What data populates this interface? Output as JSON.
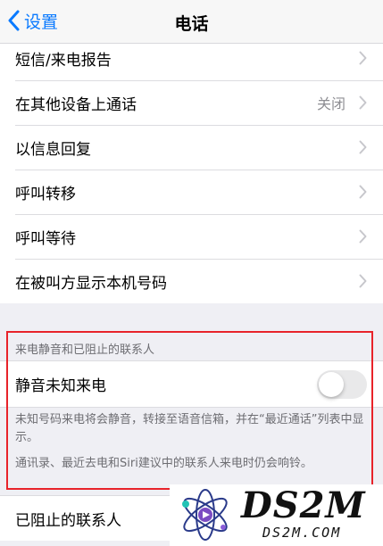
{
  "nav": {
    "back_label": "设置",
    "title": "电话"
  },
  "rows": [
    {
      "label": "短信/来电报告",
      "value": ""
    },
    {
      "label": "在其他设备上通话",
      "value": "关闭"
    },
    {
      "label": "以信息回复",
      "value": ""
    },
    {
      "label": "呼叫转移",
      "value": ""
    },
    {
      "label": "呼叫等待",
      "value": ""
    },
    {
      "label": "在被叫方显示本机号码",
      "value": ""
    }
  ],
  "silence_section": {
    "header": "来电静音和已阻止的联系人",
    "toggle_label": "静音未知来电",
    "toggle_on": false,
    "note1": "未知号码来电将会静音，转接至语音信箱，并在“最近通话”列表中显示。",
    "note2": "通讯录、最近去电和Siri建议中的联系人来电时仍会响铃。"
  },
  "blocked": {
    "label": "已阻止的联系人"
  },
  "watermark": {
    "brand": "DS2M",
    "site": "DS2M.COM"
  },
  "colors": {
    "accent": "#0a7aff",
    "highlight": "#e8232a",
    "background": "#efeff4"
  }
}
